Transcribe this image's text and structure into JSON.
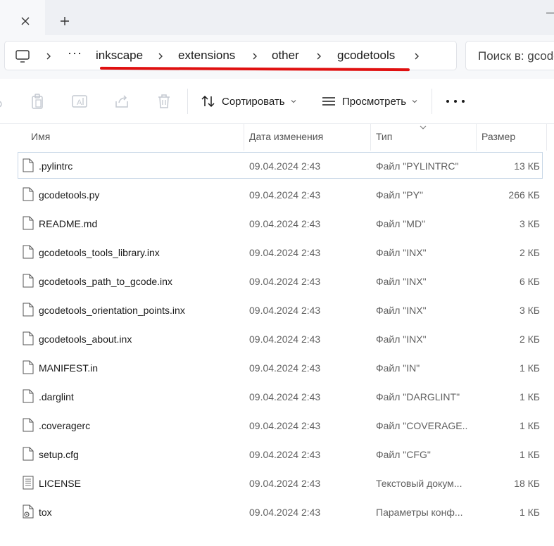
{
  "tabs": {
    "close_icon": "close-icon",
    "new_tab_icon": "plus-icon"
  },
  "address": {
    "breadcrumbs": [
      "inkscape",
      "extensions",
      "other",
      "gcodetools"
    ],
    "more_label": "···",
    "underline_color": "#e01010"
  },
  "search": {
    "placeholder": "Поиск в: gcodetools"
  },
  "toolbar": {
    "sort_label": "Сортировать",
    "view_label": "Просмотреть"
  },
  "columns": {
    "name": "Имя",
    "date": "Дата изменения",
    "type": "Тип",
    "size": "Размер"
  },
  "files": [
    {
      "name": ".pylintrc",
      "date": "09.04.2024 2:43",
      "type": "Файл \"PYLINTRC\"",
      "size": "13 КБ",
      "icon": "file-icon"
    },
    {
      "name": "gcodetools.py",
      "date": "09.04.2024 2:43",
      "type": "Файл \"PY\"",
      "size": "266 КБ",
      "icon": "file-icon"
    },
    {
      "name": "README.md",
      "date": "09.04.2024 2:43",
      "type": "Файл \"MD\"",
      "size": "3 КБ",
      "icon": "file-icon"
    },
    {
      "name": "gcodetools_tools_library.inx",
      "date": "09.04.2024 2:43",
      "type": "Файл \"INX\"",
      "size": "2 КБ",
      "icon": "file-icon"
    },
    {
      "name": "gcodetools_path_to_gcode.inx",
      "date": "09.04.2024 2:43",
      "type": "Файл \"INX\"",
      "size": "6 КБ",
      "icon": "file-icon"
    },
    {
      "name": "gcodetools_orientation_points.inx",
      "date": "09.04.2024 2:43",
      "type": "Файл \"INX\"",
      "size": "3 КБ",
      "icon": "file-icon"
    },
    {
      "name": "gcodetools_about.inx",
      "date": "09.04.2024 2:43",
      "type": "Файл \"INX\"",
      "size": "2 КБ",
      "icon": "file-icon"
    },
    {
      "name": "MANIFEST.in",
      "date": "09.04.2024 2:43",
      "type": "Файл \"IN\"",
      "size": "1 КБ",
      "icon": "file-icon"
    },
    {
      "name": ".darglint",
      "date": "09.04.2024 2:43",
      "type": "Файл \"DARGLINT\"",
      "size": "1 КБ",
      "icon": "file-icon"
    },
    {
      "name": ".coveragerc",
      "date": "09.04.2024 2:43",
      "type": "Файл \"COVERAGE...",
      "size": "1 КБ",
      "icon": "file-icon"
    },
    {
      "name": "setup.cfg",
      "date": "09.04.2024 2:43",
      "type": "Файл \"CFG\"",
      "size": "1 КБ",
      "icon": "file-icon"
    },
    {
      "name": "LICENSE",
      "date": "09.04.2024 2:43",
      "type": "Текстовый докум...",
      "size": "18 КБ",
      "icon": "text-document-icon"
    },
    {
      "name": "tox",
      "date": "09.04.2024 2:43",
      "type": "Параметры конф...",
      "size": "1 КБ",
      "icon": "settings-file-icon"
    }
  ]
}
